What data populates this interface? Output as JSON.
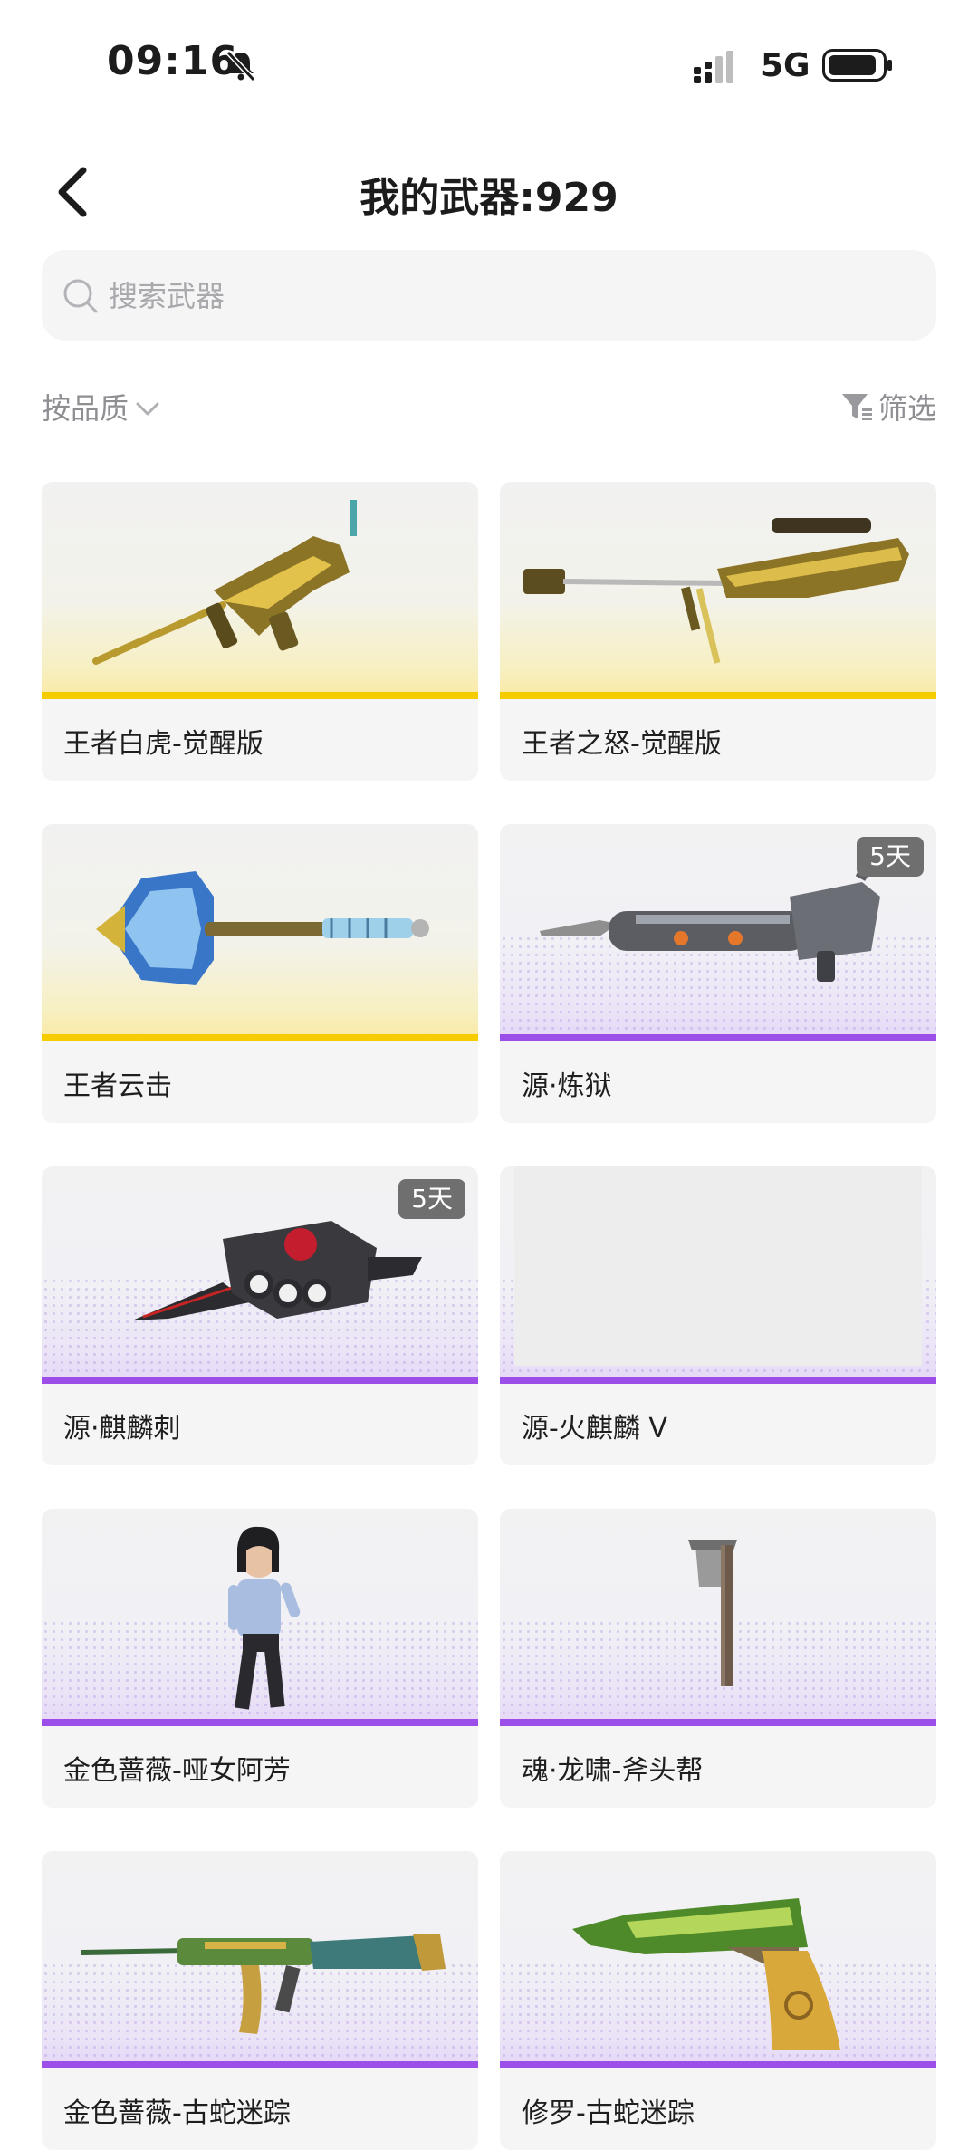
{
  "status_bar": {
    "time": "09:16",
    "network": "5G"
  },
  "header": {
    "title": "我的武器:929"
  },
  "search": {
    "placeholder": "搜索武器",
    "value": ""
  },
  "toolbar": {
    "sort_label": "按品质",
    "filter_label": "筛选"
  },
  "colors": {
    "gold": "#f4cc00",
    "purple": "#9c4ee8"
  },
  "weapons": [
    {
      "name": "王者白虎-觉醒版",
      "rarity": "gold",
      "badge": "",
      "icon": "rifle-icon"
    },
    {
      "name": "王者之怒-觉醒版",
      "rarity": "gold",
      "badge": "",
      "icon": "sniper-icon"
    },
    {
      "name": "王者云击",
      "rarity": "gold",
      "badge": "",
      "icon": "axe-icon"
    },
    {
      "name": "源·炼狱",
      "rarity": "purple",
      "badge": "5天",
      "icon": "gatling-icon"
    },
    {
      "name": "源·麒麟刺",
      "rarity": "purple",
      "badge": "5天",
      "icon": "knuckle-blade-icon"
    },
    {
      "name": "源-火麒麟 V",
      "rarity": "purple",
      "badge": "",
      "icon": "empty-image"
    },
    {
      "name": "金色蔷薇-哑女阿芳",
      "rarity": "purple",
      "badge": "",
      "icon": "character-icon"
    },
    {
      "name": "魂·龙啸-斧头帮",
      "rarity": "purple",
      "badge": "",
      "icon": "hatchet-icon"
    },
    {
      "name": "金色蔷薇-古蛇迷踪",
      "rarity": "purple",
      "badge": "",
      "icon": "assault-rifle-icon"
    },
    {
      "name": "修罗-古蛇迷踪",
      "rarity": "purple",
      "badge": "",
      "icon": "pistol-icon"
    }
  ]
}
